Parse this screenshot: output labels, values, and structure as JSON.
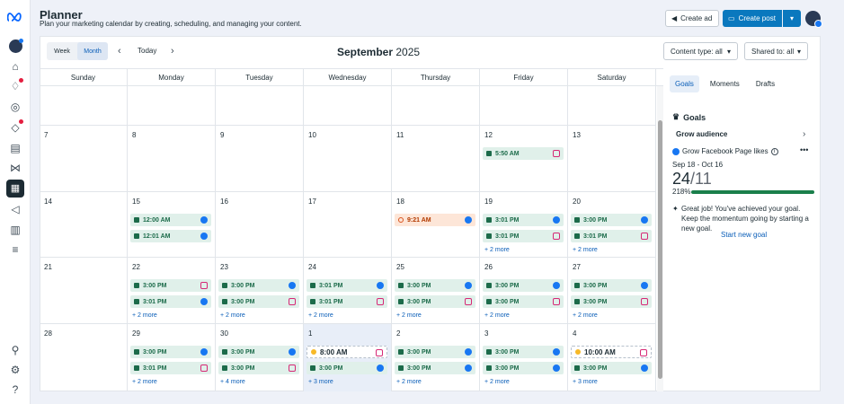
{
  "header": {
    "title": "Planner",
    "subtitle": "Plan your marketing calendar by creating, scheduling, and managing your content.",
    "create_ad": "Create ad",
    "create_post": "Create post"
  },
  "toolbar": {
    "week": "Week",
    "month": "Month",
    "today": "Today",
    "month_name": "September",
    "year": "2025",
    "content_type": "Content type: all",
    "shared_to": "Shared to: all"
  },
  "day_names": [
    "Sunday",
    "Monday",
    "Tuesday",
    "Wednesday",
    "Thursday",
    "Friday",
    "Saturday"
  ],
  "weeks": [
    [
      {
        "d": ""
      },
      {
        "d": ""
      },
      {
        "d": ""
      },
      {
        "d": ""
      },
      {
        "d": ""
      },
      {
        "d": ""
      },
      {
        "d": ""
      }
    ],
    [
      {
        "d": "7"
      },
      {
        "d": "8"
      },
      {
        "d": "9"
      },
      {
        "d": "10"
      },
      {
        "d": "11"
      },
      {
        "d": "12",
        "events": [
          {
            "t": "5:50 AM",
            "p": "ig"
          }
        ]
      },
      {
        "d": "13"
      }
    ],
    [
      {
        "d": "14"
      },
      {
        "d": "15",
        "events": [
          {
            "t": "12:00 AM",
            "p": "fb"
          },
          {
            "t": "12:01 AM",
            "p": "fb"
          }
        ]
      },
      {
        "d": "16"
      },
      {
        "d": "17"
      },
      {
        "d": "18",
        "events": [
          {
            "t": "9:21 AM",
            "p": "fb",
            "k": "warn"
          }
        ]
      },
      {
        "d": "19",
        "events": [
          {
            "t": "3:01 PM",
            "p": "fb"
          },
          {
            "t": "3:01 PM",
            "p": "ig"
          }
        ],
        "more": "+ 2 more"
      },
      {
        "d": "20",
        "events": [
          {
            "t": "3:00 PM",
            "p": "fb"
          },
          {
            "t": "3:01 PM",
            "p": "ig"
          }
        ],
        "more": "+ 2 more"
      }
    ],
    [
      {
        "d": "21"
      },
      {
        "d": "22",
        "events": [
          {
            "t": "3:00 PM",
            "p": "ig"
          },
          {
            "t": "3:01 PM",
            "p": "fb"
          }
        ],
        "more": "+ 2 more"
      },
      {
        "d": "23",
        "events": [
          {
            "t": "3:00 PM",
            "p": "fb"
          },
          {
            "t": "3:00 PM",
            "p": "ig"
          }
        ],
        "more": "+ 2 more"
      },
      {
        "d": "24",
        "events": [
          {
            "t": "3:01 PM",
            "p": "fb"
          },
          {
            "t": "3:01 PM",
            "p": "ig"
          }
        ],
        "more": "+ 2 more"
      },
      {
        "d": "25",
        "events": [
          {
            "t": "3:00 PM",
            "p": "fb"
          },
          {
            "t": "3:00 PM",
            "p": "ig"
          }
        ],
        "more": "+ 2 more"
      },
      {
        "d": "26",
        "events": [
          {
            "t": "3:00 PM",
            "p": "fb"
          },
          {
            "t": "3:00 PM",
            "p": "ig"
          }
        ],
        "more": "+ 2 more"
      },
      {
        "d": "27",
        "events": [
          {
            "t": "3:00 PM",
            "p": "fb"
          },
          {
            "t": "3:00 PM",
            "p": "ig"
          }
        ],
        "more": "+ 2 more"
      }
    ],
    [
      {
        "d": "28"
      },
      {
        "d": "29",
        "events": [
          {
            "t": "3:00 PM",
            "p": "fb"
          },
          {
            "t": "3:01 PM",
            "p": "ig"
          }
        ],
        "more": "+ 2 more"
      },
      {
        "d": "30",
        "events": [
          {
            "t": "3:00 PM",
            "p": "fb"
          },
          {
            "t": "3:00 PM",
            "p": "ig"
          }
        ],
        "more": "+ 4 more"
      },
      {
        "d": "1",
        "sel": true,
        "events": [
          {
            "t": "8:00 AM",
            "p": "ig",
            "k": "dashed"
          },
          {
            "t": "3:00 PM",
            "p": "fb"
          }
        ],
        "more": "+ 3 more"
      },
      {
        "d": "2",
        "events": [
          {
            "t": "3:00 PM",
            "p": "fb"
          },
          {
            "t": "3:00 PM",
            "p": "fb"
          }
        ],
        "more": "+ 2 more"
      },
      {
        "d": "3",
        "events": [
          {
            "t": "3:00 PM",
            "p": "fb"
          },
          {
            "t": "3:00 PM",
            "p": "fb"
          }
        ],
        "more": "+ 2 more"
      },
      {
        "d": "4",
        "events": [
          {
            "t": "10:00 AM",
            "p": "ig",
            "k": "dashed"
          },
          {
            "t": "3:00 PM",
            "p": "fb"
          }
        ],
        "more": "+ 3 more"
      }
    ]
  ],
  "panel": {
    "tabs": [
      "Goals",
      "Moments",
      "Drafts"
    ],
    "goals_heading": "Goals",
    "grow_audience": "Grow audience",
    "fb_likes": "Grow Facebook Page likes",
    "date_range": "Sep 18 - Oct 16",
    "current": "24",
    "target": "11",
    "percent": "218%",
    "progress_fraction": 1.0,
    "great_job": "Great job! You've achieved your goal. Keep the momentum going by starting a new goal.",
    "start_new_goal": "Start new goal"
  },
  "colors": {
    "primary": "#0a78be",
    "event_bg": "#e0f0ea",
    "event_text": "#1c6b4a",
    "facebook": "#1877f2",
    "instagram": "#d62976",
    "progress": "#1a7f4b"
  },
  "rail_icons": [
    "meta-logo-icon",
    "account-avatar-icon",
    "home-icon",
    "notifications-icon",
    "compass-icon",
    "ads-icon",
    "inbox-icon",
    "handshake-icon",
    "planner-icon",
    "megaphone-icon",
    "insights-icon",
    "menu-icon",
    "search-icon",
    "settings-icon",
    "help-icon"
  ]
}
